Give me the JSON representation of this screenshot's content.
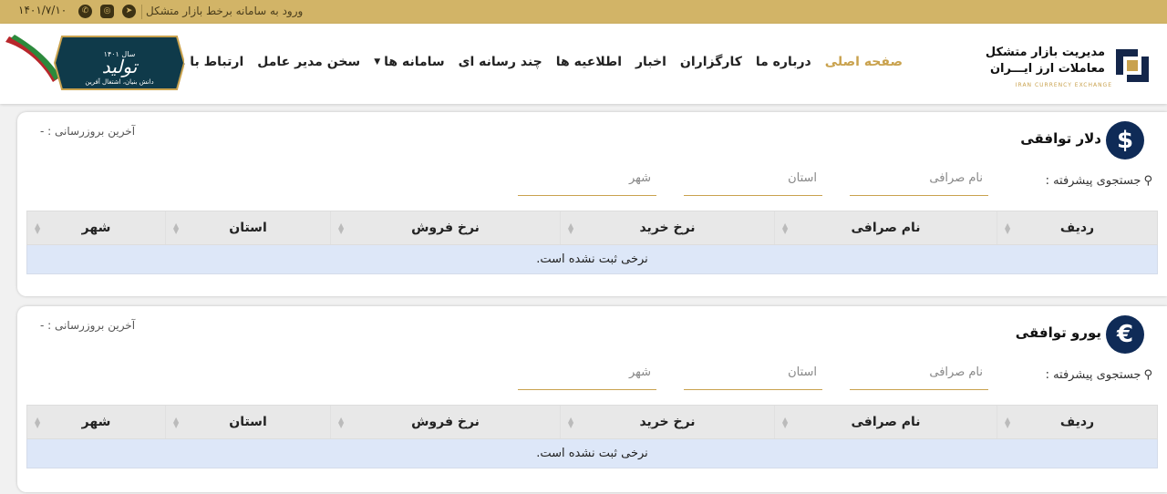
{
  "topbar": {
    "notice": "ورود به سامانه برخط بازار متشکل",
    "date": "۱۴۰۱/۷/۱۰",
    "social_icons": [
      "telegram-icon",
      "instagram-icon",
      "messenger-icon"
    ]
  },
  "brand": {
    "line1": "مدیریت بازار متشکل",
    "line2": "معاملات ارز ایـــران",
    "line3": "IRAN CURRENCY EXCHANGE"
  },
  "nav": {
    "items": [
      {
        "label": "صفحه اصلی",
        "active": true
      },
      {
        "label": "درباره ما"
      },
      {
        "label": "کارگزاران"
      },
      {
        "label": "اخبار"
      },
      {
        "label": "اطلاعیه ها"
      },
      {
        "label": "چند رسانه ای"
      },
      {
        "label": "سامانه ها",
        "dropdown": true
      },
      {
        "label": "سخن مدیر عامل"
      },
      {
        "label": "ارتباط با ما"
      }
    ]
  },
  "badge": {
    "year_label": "سال ۱۴۰۱",
    "title": "تولید",
    "subtitle": "دانش بنیان، اشتغال آفرین"
  },
  "cards": [
    {
      "icon_symbol": "$",
      "title": "دلار توافقی",
      "last_update": "آخرین بروزرسانی : -",
      "advanced_search": "جستجوی پیشرفته :",
      "placeholders": {
        "name": "نام صرافی",
        "province": "استان",
        "city": "شهر"
      },
      "columns": [
        "ردیف",
        "نام صرافی",
        "نرخ خرید",
        "نرخ فروش",
        "استان",
        "شهر"
      ],
      "empty_message": "نرخی ثبت نشده است."
    },
    {
      "icon_symbol": "€",
      "title": "یورو توافقی",
      "last_update": "آخرین بروزرسانی : -",
      "advanced_search": "جستجوی پیشرفته :",
      "placeholders": {
        "name": "نام صرافی",
        "province": "استان",
        "city": "شهر"
      },
      "columns": [
        "ردیف",
        "نام صرافی",
        "نرخ خرید",
        "نرخ فروش",
        "استان",
        "شهر"
      ],
      "empty_message": "نرخی ثبت نشده است."
    }
  ],
  "colors": {
    "gold": "#d2b467",
    "accent": "#c9a24e",
    "navy": "#0f2b57",
    "row": "#dde7f8"
  }
}
